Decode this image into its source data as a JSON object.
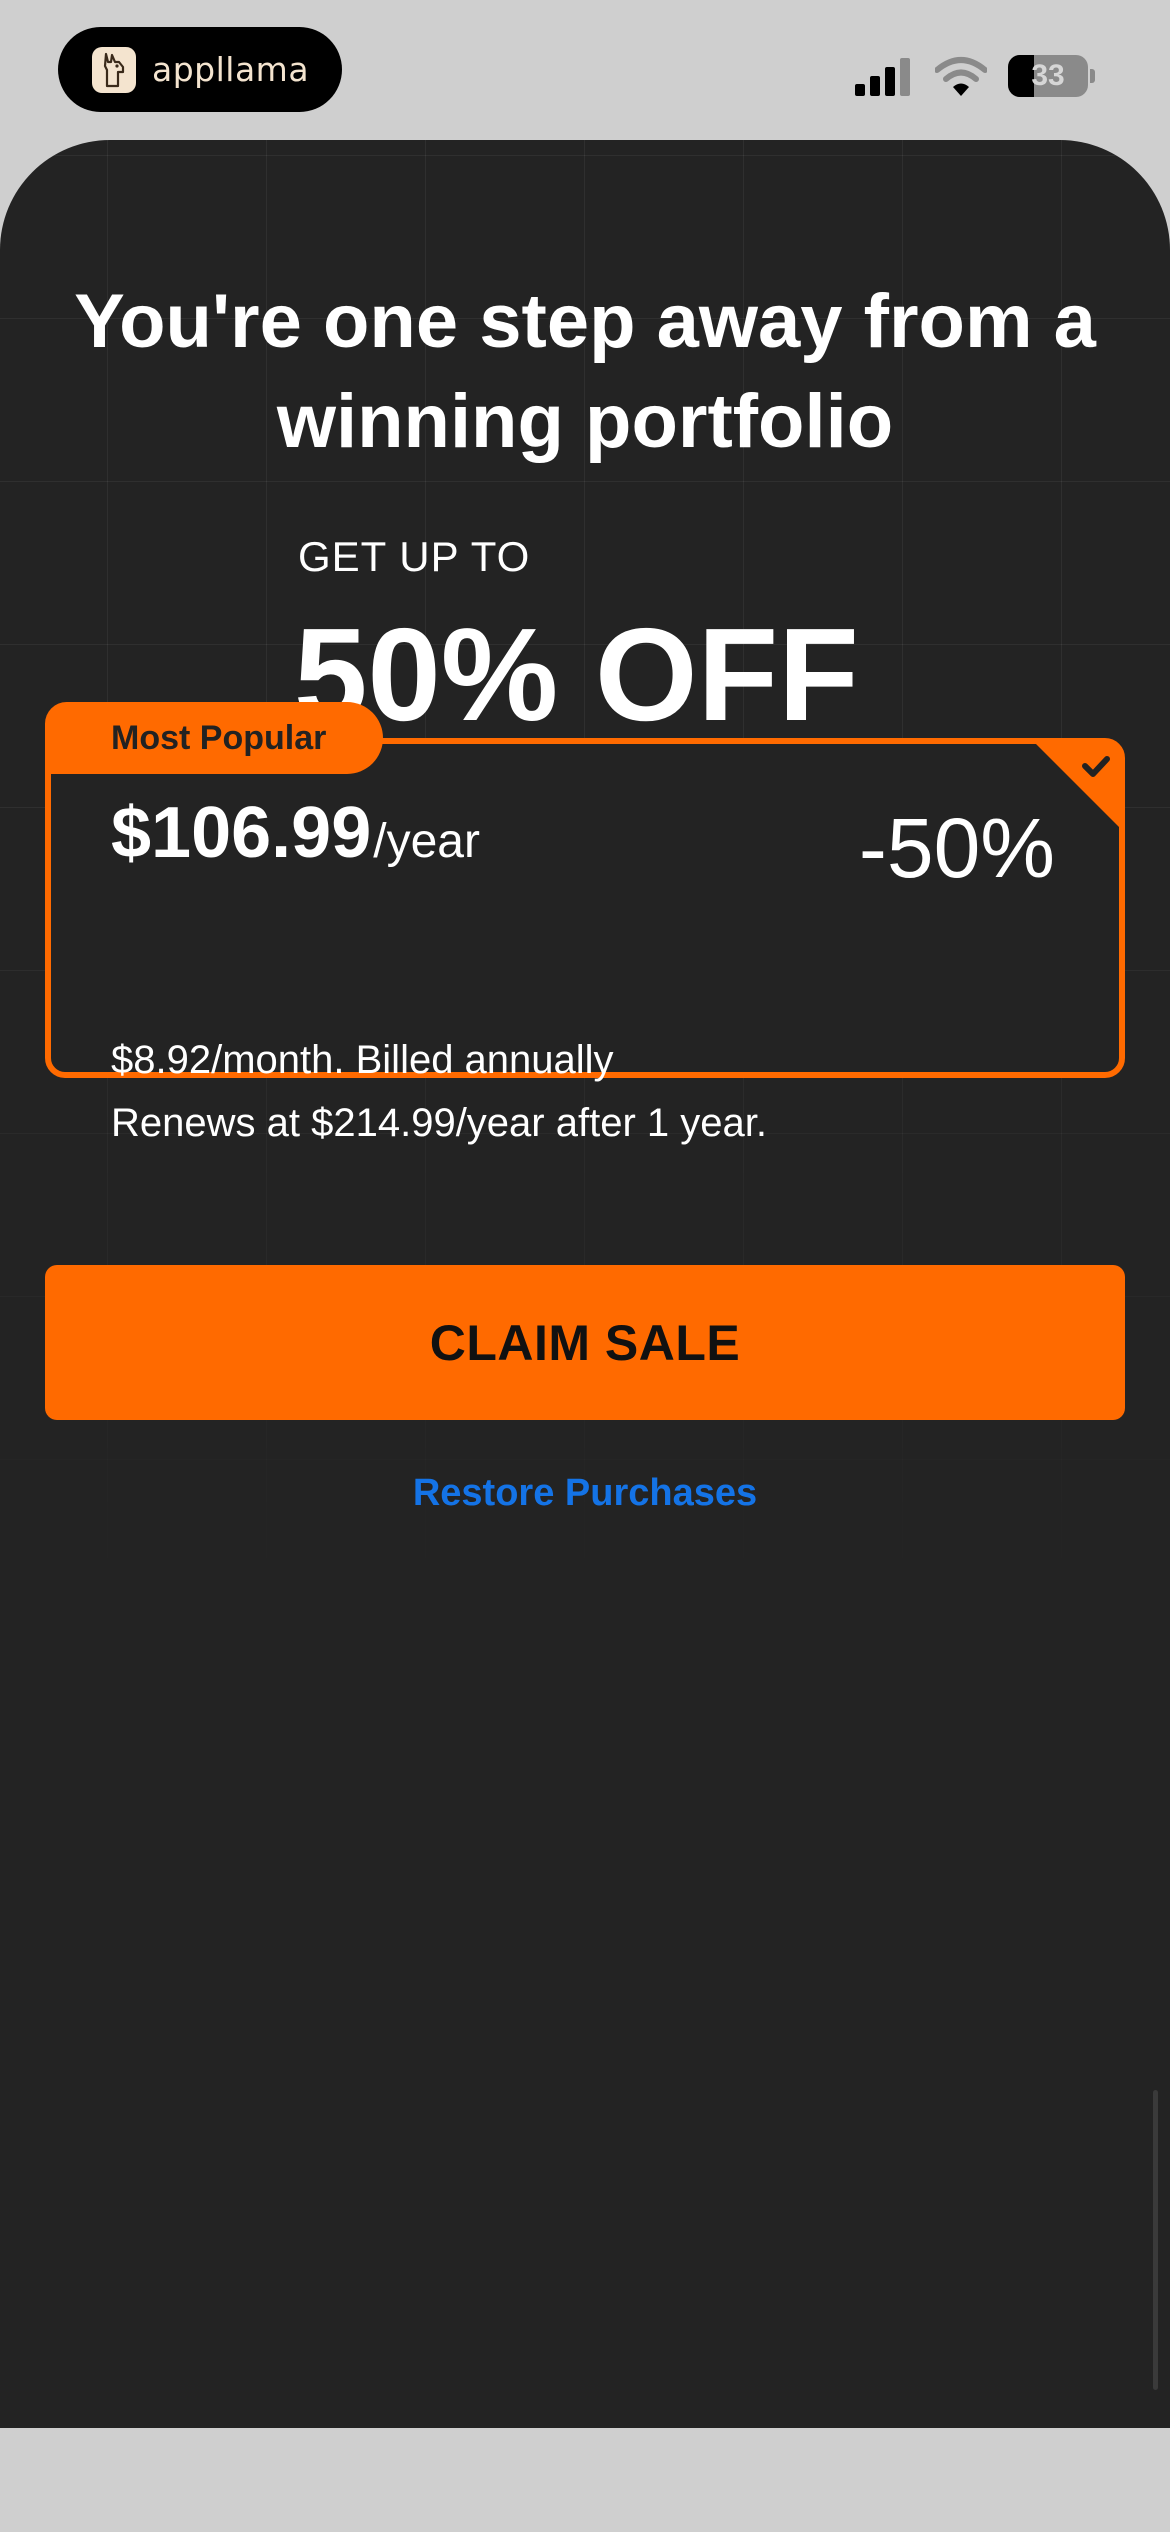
{
  "status_bar": {
    "brand_name": "appllama",
    "battery_level": "33",
    "battery_fraction": 0.33
  },
  "hero": {
    "headline": "You're one step away from a winning portfolio",
    "eyebrow": "GET UP TO",
    "offer": "50% OFF"
  },
  "plan": {
    "badge": "Most Popular",
    "price": "$106.99",
    "period": "/year",
    "discount": "-50%",
    "monthly_note": "$8.92/month. Billed annually",
    "renewal_note": "Renews at $214.99/year after 1 year.",
    "selected": true
  },
  "actions": {
    "claim_label": "CLAIM SALE",
    "restore_label": "Restore Purchases"
  },
  "colors": {
    "accent": "#ff6a00",
    "sheet_background": "#232323",
    "link": "#1473e6"
  },
  "icons": {
    "brand": "llama-logo-icon",
    "signal": "cellular-signal-icon",
    "wifi": "wifi-icon",
    "battery": "battery-icon",
    "selected": "checkmark-icon"
  }
}
